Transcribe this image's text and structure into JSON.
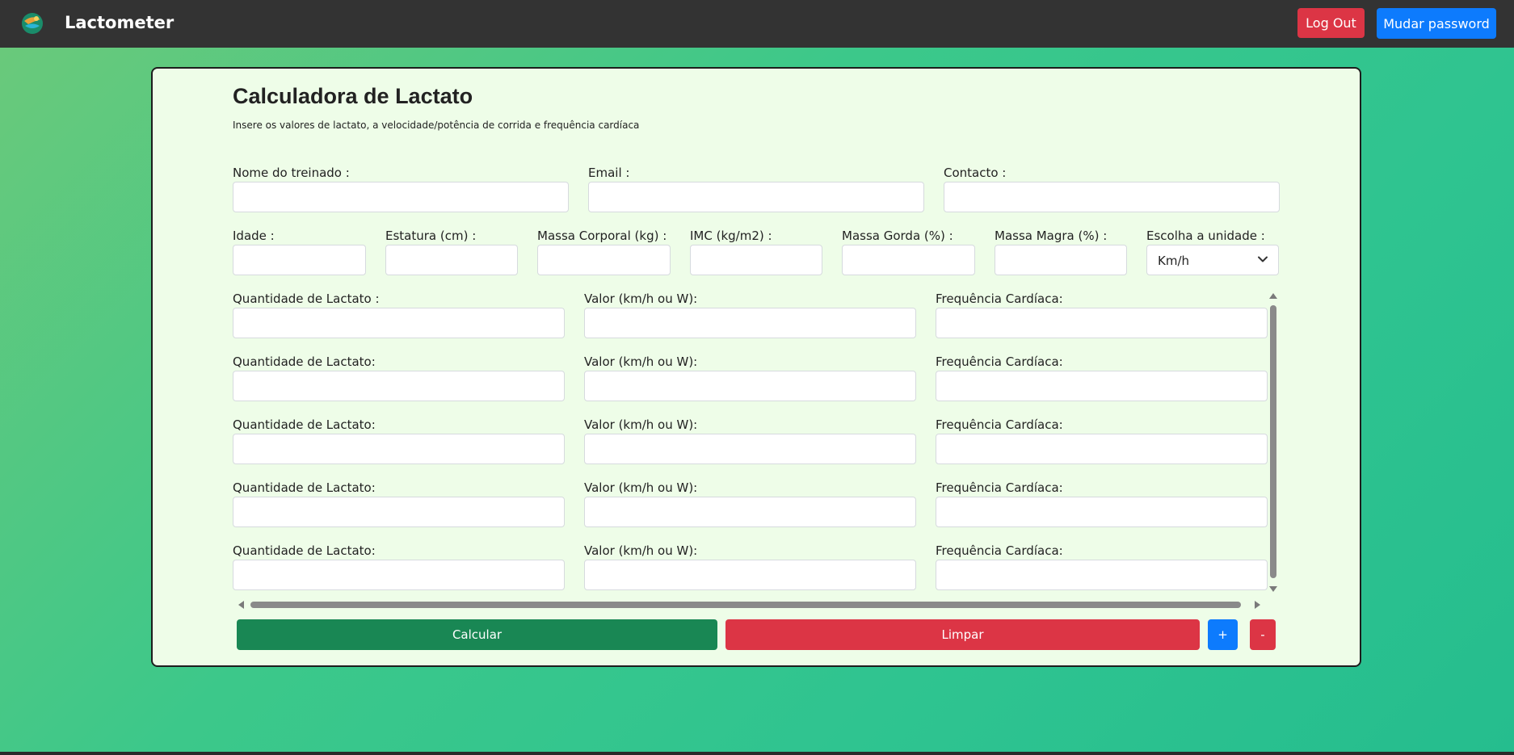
{
  "navbar": {
    "brand": "Lactometer",
    "logout_label": "Log Out",
    "change_password_label": "Mudar password"
  },
  "form": {
    "title": "Calculadora de Lactato",
    "subtitle": "Insere os valores de lactato, a velocidade/potência de corrida e frequência cardíaca",
    "labels": {
      "nome": "Nome do treinado :",
      "email": "Email :",
      "contacto": "Contacto :",
      "idade": "Idade :",
      "estatura": "Estatura (cm) :",
      "massa_corporal": "Massa Corporal (kg) :",
      "imc": "IMC (kg/m2) :",
      "massa_gorda": "Massa Gorda (%) :",
      "massa_magra": "Massa Magra (%) :",
      "unidade": "Escolha a unidade :"
    },
    "unit_selected": "Km/h",
    "measurement_rows": [
      {
        "lactato": "Quantidade de Lactato :",
        "valor": "Valor (km/h ou W):",
        "fc": "Frequência Cardíaca:"
      },
      {
        "lactato": "Quantidade de Lactato:",
        "valor": "Valor (km/h ou W):",
        "fc": "Frequência Cardíaca:"
      },
      {
        "lactato": "Quantidade de Lactato:",
        "valor": "Valor (km/h ou W):",
        "fc": "Frequência Cardíaca:"
      },
      {
        "lactato": "Quantidade de Lactato:",
        "valor": "Valor (km/h ou W):",
        "fc": "Frequência Cardíaca:"
      },
      {
        "lactato": "Quantidade de Lactato:",
        "valor": "Valor (km/h ou W):",
        "fc": "Frequência Cardíaca:"
      }
    ],
    "buttons": {
      "calcular": "Calcular",
      "limpar": "Limpar",
      "add": "+",
      "remove": "-"
    }
  },
  "colors": {
    "navbar": "#333333",
    "card_bg": "#eefde8",
    "primary": "#0d7bfd",
    "danger": "#dc3545",
    "success": "#198754"
  }
}
